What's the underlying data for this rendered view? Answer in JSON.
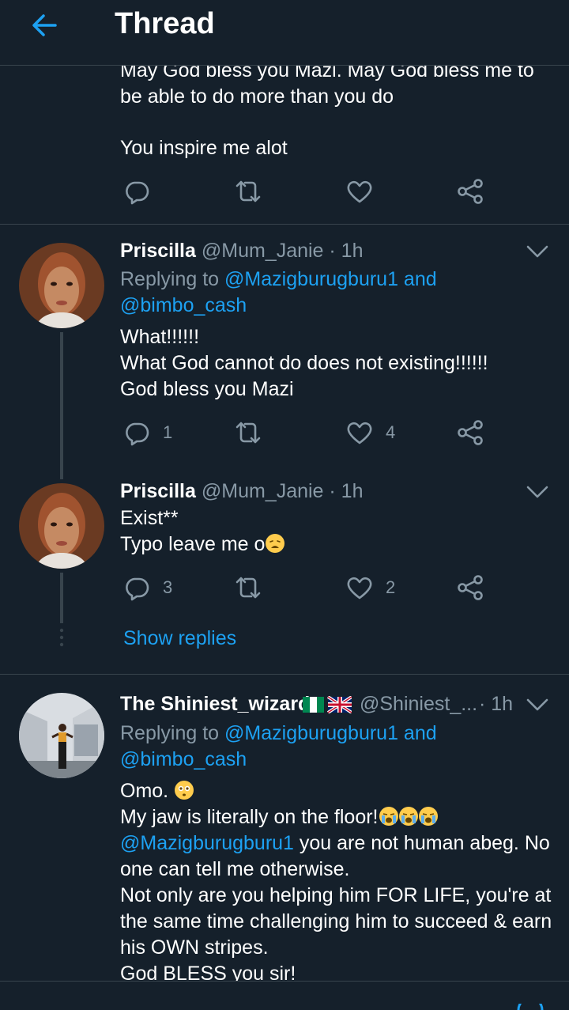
{
  "header": {
    "title": "Thread"
  },
  "top_tweet": {
    "lines": [
      "May God bless you Mazi. May God bless me to",
      "be able to do more than you do",
      "",
      "You inspire me alot"
    ]
  },
  "tweet1": {
    "name": "Priscilla",
    "meta": "@Mum_Janie · 1h",
    "replying_prefix": "Replying to ",
    "replying_to1": "@Mazigburugburu1",
    "replying_and": " and",
    "replying_to2": "@bimbo_cash",
    "body": [
      "What!!!!!!",
      "What God cannot do does not existing!!!!!!",
      "God bless you Mazi"
    ],
    "reply_count": "1",
    "like_count": "4"
  },
  "tweet2": {
    "name": "Priscilla",
    "meta": "@Mum_Janie · 1h",
    "body": [
      "Exist**",
      "Typo leave me o"
    ],
    "reply_count": "3",
    "like_count": "2",
    "show_replies": "Show replies"
  },
  "tweet3": {
    "name": "The Shiniest_wizard",
    "flags": "🇳🇬🇬🇧",
    "handle": "@Shiniest_...",
    "time": "· 1h",
    "replying_prefix": "Replying to ",
    "replying_to1": "@Mazigburugburu1",
    "replying_and": " and",
    "replying_to2": "@bimbo_cash",
    "line1": "Omo.",
    "line2": "My jaw is literally on the floor!",
    "mention": "@Mazigburugburu1",
    "line3_rest": " you are not human abeg. No",
    "line4": "one can tell me otherwise.",
    "line5": "Not only are you helping him FOR LIFE, you're at",
    "line6": "the same time challenging him to succeed & earn",
    "line7": "his OWN stripes.",
    "line8": "God BLESS you sir!"
  },
  "colors": {
    "background": "#15202b",
    "accent": "#1da1f2",
    "muted": "#8899a6",
    "divider": "#38444d"
  }
}
